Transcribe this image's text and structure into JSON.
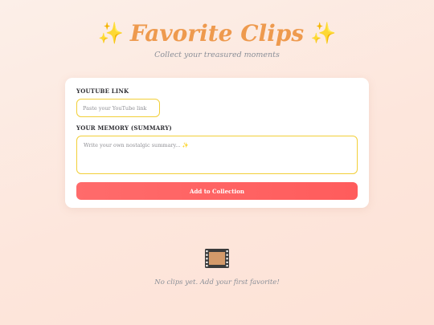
{
  "header": {
    "title": "Favorite Clips",
    "subtitle": "Collect your treasured moments",
    "left_icon": "sparkles-icon",
    "right_icon": "sparkles-icon"
  },
  "form": {
    "link_label": "YOUTUBE LINK",
    "link_placeholder": "Paste your YouTube link",
    "link_value": "",
    "memory_label": "YOUR MEMORY (SUMMARY)",
    "memory_placeholder": "Write your own nostalgic summary... ✨",
    "memory_value": "",
    "submit_label": "Add to Collection"
  },
  "empty_state": {
    "icon": "film-strip-icon",
    "message": "No clips yet. Add your first favorite!"
  },
  "colors": {
    "title": "#ee9a4e",
    "accent_border": "#f2cf38",
    "button": "#ff5c5c",
    "muted_text": "#8a8f98"
  }
}
